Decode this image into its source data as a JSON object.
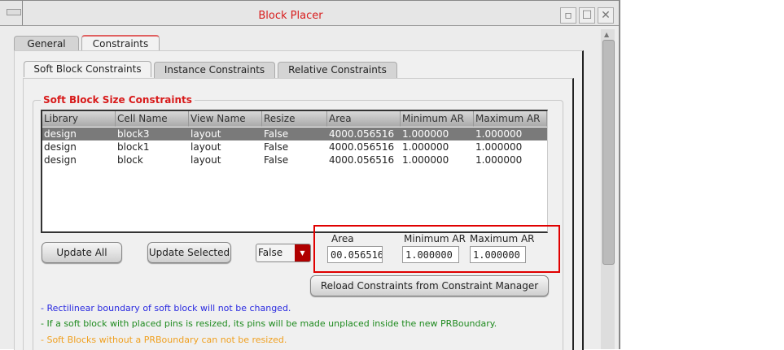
{
  "window": {
    "title": "Block Placer"
  },
  "outer_tabs": [
    {
      "label": "General"
    },
    {
      "label": "Constraints"
    }
  ],
  "inner_tabs": [
    {
      "label": "Soft Block Constraints"
    },
    {
      "label": "Instance Constraints"
    },
    {
      "label": "Relative Constraints"
    }
  ],
  "group_title": "Soft Block Size Constraints",
  "table": {
    "columns": [
      "Library",
      "Cell Name",
      "View Name",
      "Resize",
      "Area",
      "Minimum AR",
      "Maximum AR"
    ],
    "rows": [
      [
        "design",
        "block3",
        "layout",
        "False",
        "4000.056516",
        "1.000000",
        "1.000000"
      ],
      [
        "design",
        "block1",
        "layout",
        "False",
        "4000.056516",
        "1.000000",
        "1.000000"
      ],
      [
        "design",
        "block",
        "layout",
        "False",
        "4000.056516",
        "1.000000",
        "1.000000"
      ]
    ]
  },
  "buttons": {
    "update_all": "Update All",
    "update_selected": "Update Selected",
    "reload": "Reload Constraints from Constraint Manager"
  },
  "resize_select": {
    "value": "False"
  },
  "fields": {
    "area_label": "Area",
    "area_value": "00.056516",
    "min_label": "Minimum AR",
    "min_value": "1.000000",
    "max_label": "Maximum AR",
    "max_value": "1.000000"
  },
  "notes": [
    {
      "text": "- Rectilinear boundary of soft block will not be changed.",
      "color": "#2a2ae0"
    },
    {
      "text": "- If a soft block with placed pins is resized, its pins will be made unplaced inside the new PRBoundary.",
      "color": "#1e8a1e"
    },
    {
      "text": "- Soft Blocks without a PRBoundary can not be resized.",
      "color": "#f0a020"
    }
  ],
  "colors": {
    "title": "#d81c1c",
    "highlight_box": "#e00000"
  }
}
